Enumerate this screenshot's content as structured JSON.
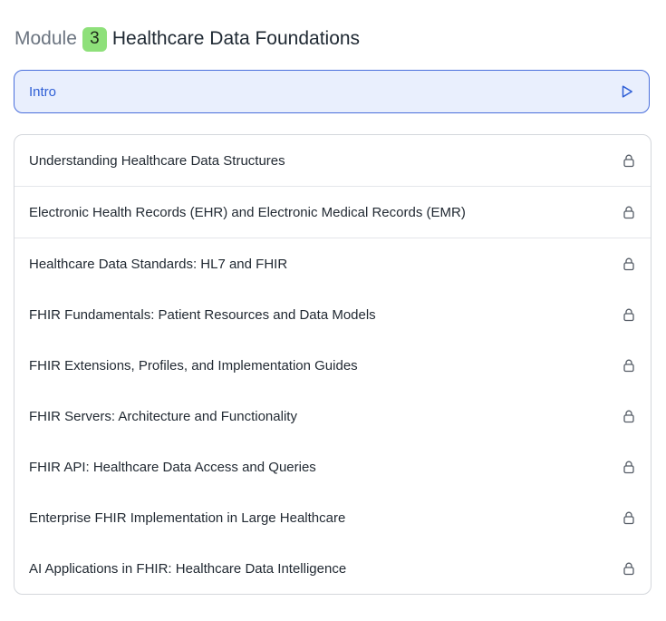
{
  "header": {
    "module_word": "Module",
    "module_number": "3",
    "module_title": "Healthcare Data Foundations"
  },
  "intro": {
    "label": "Intro",
    "icon": "play-icon"
  },
  "lessons": [
    {
      "title": "Understanding Healthcare Data Structures",
      "icon": "lock-icon"
    },
    {
      "title": "Electronic Health Records (EHR) and Electronic Medical Records (EMR)",
      "icon": "lock-icon"
    },
    {
      "title": "Healthcare Data Standards: HL7 and FHIR",
      "icon": "lock-icon"
    },
    {
      "title": "FHIR Fundamentals: Patient Resources and Data Models",
      "icon": "lock-icon"
    },
    {
      "title": "FHIR Extensions, Profiles, and Implementation Guides",
      "icon": "lock-icon"
    },
    {
      "title": "FHIR Servers: Architecture and Functionality",
      "icon": "lock-icon"
    },
    {
      "title": "FHIR API: Healthcare Data Access and Queries",
      "icon": "lock-icon"
    },
    {
      "title": "Enterprise FHIR Implementation in Large Healthcare",
      "icon": "lock-icon"
    },
    {
      "title": "AI Applications in FHIR: Healthcare Data Intelligence",
      "icon": "lock-icon"
    }
  ],
  "colors": {
    "accent": "#2f5fd6",
    "intro_bg": "#e9effd",
    "badge_bg": "#8ee07a",
    "border": "#d4d7dc"
  }
}
